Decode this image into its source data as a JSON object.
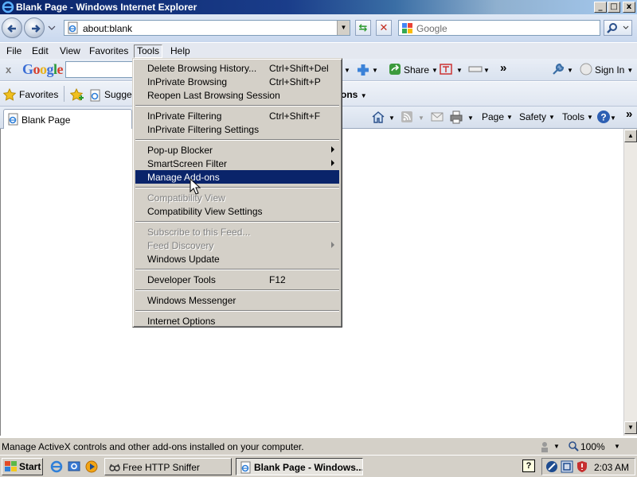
{
  "window": {
    "title": "Blank Page - Windows Internet Explorer",
    "min": "_",
    "max": "□",
    "close": "x"
  },
  "address": {
    "url": "about:blank",
    "search_placeholder": "Google"
  },
  "menubar": {
    "file": "File",
    "edit": "Edit",
    "view": "View",
    "favorites": "Favorites",
    "tools": "Tools",
    "help": "Help"
  },
  "google_toolbar": {
    "close": "x",
    "logo": "Google",
    "share": "Share",
    "sign_in": "Sign In",
    "more": "»"
  },
  "favorites_bar": {
    "favorites": "Favorites",
    "suggested": "Sugges",
    "ons": "ons"
  },
  "tab": {
    "label": "Blank Page"
  },
  "command_bar": {
    "page": "Page",
    "safety": "Safety",
    "tools": "Tools",
    "more": "»"
  },
  "tools_menu": {
    "items": [
      {
        "label": "Delete Browsing History...",
        "shortcut": "Ctrl+Shift+Del",
        "disabled": false,
        "submenu": false
      },
      {
        "label": "InPrivate Browsing",
        "shortcut": "Ctrl+Shift+P",
        "disabled": false,
        "submenu": false
      },
      {
        "label": "Reopen Last Browsing Session",
        "shortcut": "",
        "disabled": false,
        "submenu": false
      },
      {
        "label": "InPrivate Filtering",
        "shortcut": "Ctrl+Shift+F",
        "disabled": false,
        "submenu": false
      },
      {
        "label": "InPrivate Filtering Settings",
        "shortcut": "",
        "disabled": false,
        "submenu": false
      },
      {
        "label": "Pop-up Blocker",
        "shortcut": "",
        "disabled": false,
        "submenu": true
      },
      {
        "label": "SmartScreen Filter",
        "shortcut": "",
        "disabled": false,
        "submenu": true
      },
      {
        "label": "Manage Add-ons",
        "shortcut": "",
        "disabled": false,
        "submenu": false,
        "highlighted": true
      },
      {
        "label": "Compatibility View",
        "shortcut": "",
        "disabled": true,
        "submenu": false
      },
      {
        "label": "Compatibility View Settings",
        "shortcut": "",
        "disabled": false,
        "submenu": false
      },
      {
        "label": "Subscribe to this Feed...",
        "shortcut": "",
        "disabled": true,
        "submenu": false
      },
      {
        "label": "Feed Discovery",
        "shortcut": "",
        "disabled": true,
        "submenu": true
      },
      {
        "label": "Windows Update",
        "shortcut": "",
        "disabled": false,
        "submenu": false
      },
      {
        "label": "Developer Tools",
        "shortcut": "F12",
        "disabled": false,
        "submenu": false
      },
      {
        "label": "Windows Messenger",
        "shortcut": "",
        "disabled": false,
        "submenu": false
      },
      {
        "label": "Internet Options",
        "shortcut": "",
        "disabled": false,
        "submenu": false
      }
    ]
  },
  "statusbar": {
    "text": "Manage ActiveX controls and other add-ons installed on your computer.",
    "zoom": "100%"
  },
  "taskbar": {
    "start": "Start",
    "tasks": [
      {
        "label": "Free HTTP Sniffer",
        "active": false
      },
      {
        "label": "Blank Page - Windows...",
        "active": true
      }
    ],
    "help": "?",
    "clock": "2:03 AM"
  },
  "colors": {
    "menu_highlight": "#0a246a",
    "title_bar": "#0a246a",
    "face": "#d4d0c8"
  }
}
